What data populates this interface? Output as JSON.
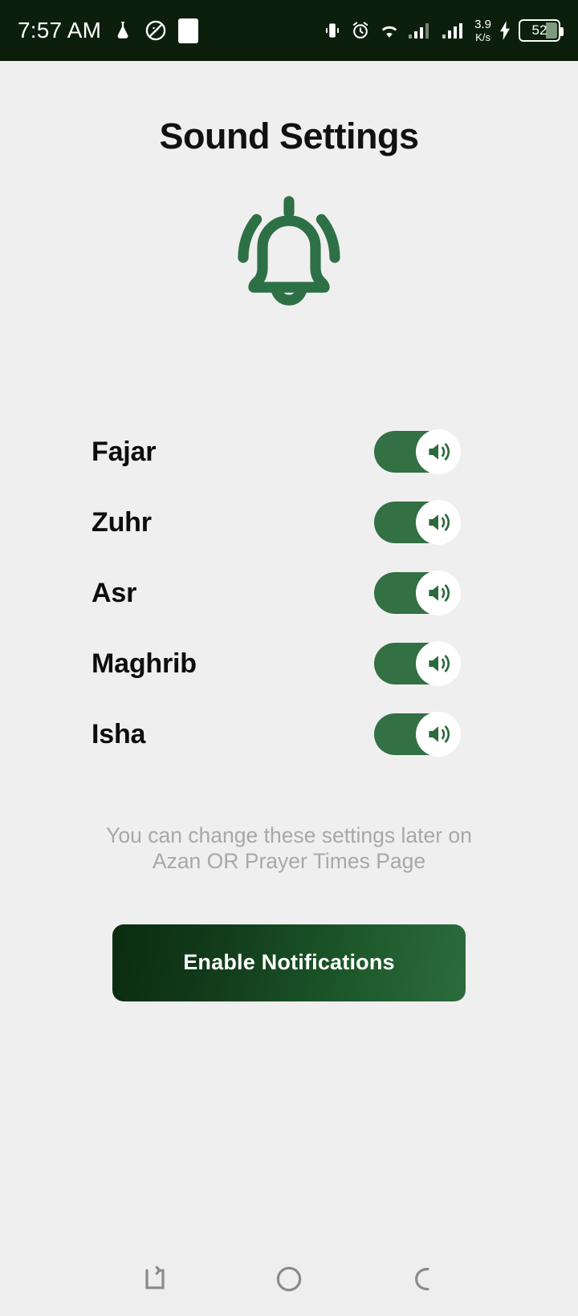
{
  "statusbar": {
    "time": "7:57 AM",
    "left_icons": [
      "flask-icon",
      "no-rotation-icon",
      "white-square-icon"
    ],
    "right_icons": [
      "vibrate-icon",
      "alarm-icon",
      "wifi-icon",
      "signal-icon-1",
      "signal-icon-2"
    ],
    "network_speed_value": "3.9",
    "network_speed_unit": "K/s",
    "charging": "charging-bolt-icon",
    "battery_percent": "52",
    "background_color": "#0c1f0c"
  },
  "header": {
    "title": "Sound Settings",
    "icon": "bell-ringing-icon",
    "icon_color": "#2e7045"
  },
  "prayers": [
    {
      "name": "Fajar",
      "enabled": true,
      "toggle_icon": "speaker-on-icon"
    },
    {
      "name": "Zuhr",
      "enabled": true,
      "toggle_icon": "speaker-on-icon"
    },
    {
      "name": "Asr",
      "enabled": true,
      "toggle_icon": "speaker-on-icon"
    },
    {
      "name": "Maghrib",
      "enabled": true,
      "toggle_icon": "speaker-on-icon"
    },
    {
      "name": "Isha",
      "enabled": true,
      "toggle_icon": "speaker-on-icon"
    }
  ],
  "hint": {
    "line1": "You can change these settings later on",
    "line2": "Azan OR Prayer Times Page",
    "color": "#a8a8a8"
  },
  "cta": {
    "label": "Enable Notifications",
    "gradient_from": "#0b2b10",
    "gradient_to": "#2c6c3b"
  },
  "navbar": {
    "items": [
      {
        "name": "recents-button",
        "icon": "recents-icon"
      },
      {
        "name": "home-button",
        "icon": "home-circle-icon"
      },
      {
        "name": "back-button",
        "icon": "back-icon"
      }
    ]
  },
  "theme": {
    "page_background": "#f0efef",
    "accent_green": "#337044",
    "title_color": "#111111"
  }
}
